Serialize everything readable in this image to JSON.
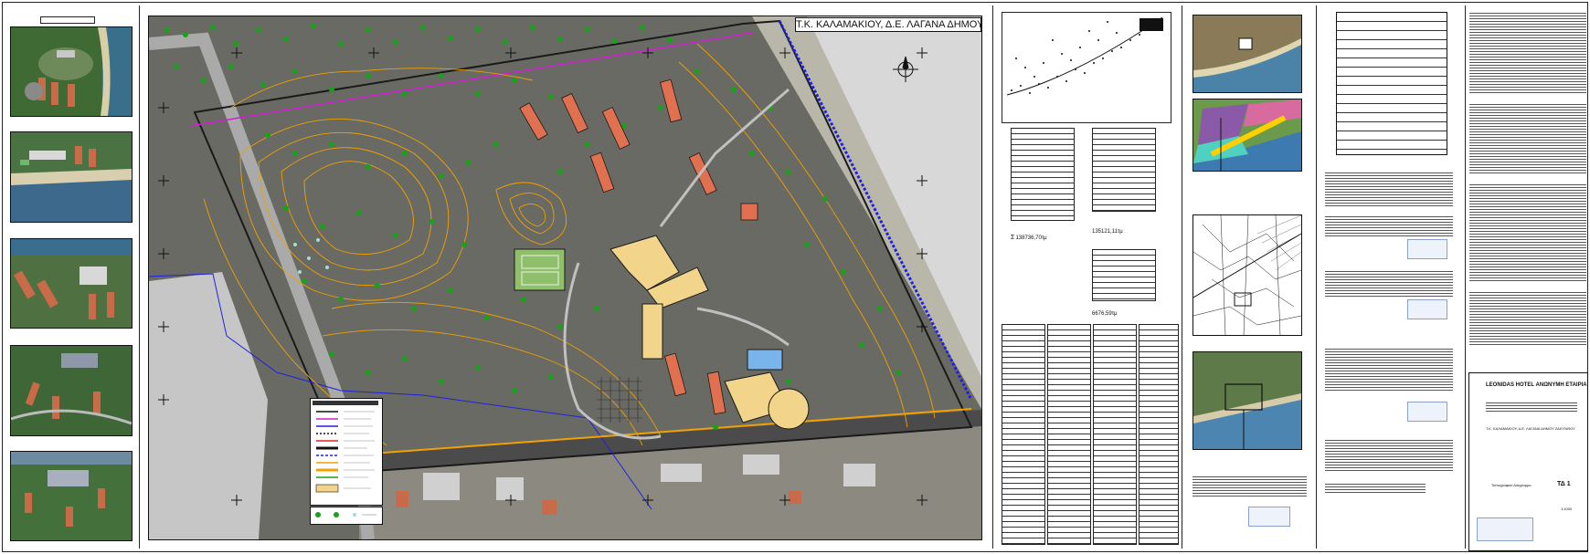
{
  "photos": {
    "title": "",
    "items": [
      {
        "caption": ""
      },
      {
        "caption": ""
      },
      {
        "caption": ""
      },
      {
        "caption": ""
      },
      {
        "caption": ""
      }
    ]
  },
  "map": {
    "title": "Τ.Κ. ΚΑΛΑΜΑΚΙΟΥ, Δ.Ε. ΛΑΓΑΝΑ ΔΗΜΟΥ ΖΑΚΥΝΘΟΥ",
    "colors": {
      "contour": "#f0a000",
      "tree": "#1aa01a",
      "boundary": "#1a1a1a",
      "blue_line": "#2020e0",
      "magenta_line": "#d020d0",
      "roof": "#e07050",
      "building": "#f2d58a"
    }
  },
  "tables": {
    "sum1_prefix": "Σ",
    "sum1_value": "138736,70τμ",
    "sum2_value": "135121,11τμ",
    "sum3_value": "6676,59τμ"
  },
  "title_block": {
    "company": "LEONIDAS HOTEL ΑΝΩΝΥΜΗ ΕΤΑΙΡΙΑ",
    "place": "Τ.Κ. ΚΑΛΑΜΑΚΙΟΥ, Δ.Ε. ΛΑΓΑΝΑ ΔΗΜΟΥ ΖΑΚΥΝΘΟΥ",
    "drawing_no": "ΤΔ 1",
    "scale": "1:1000",
    "drawing_type": "Τοπογραφικό Διάγραμμα"
  }
}
